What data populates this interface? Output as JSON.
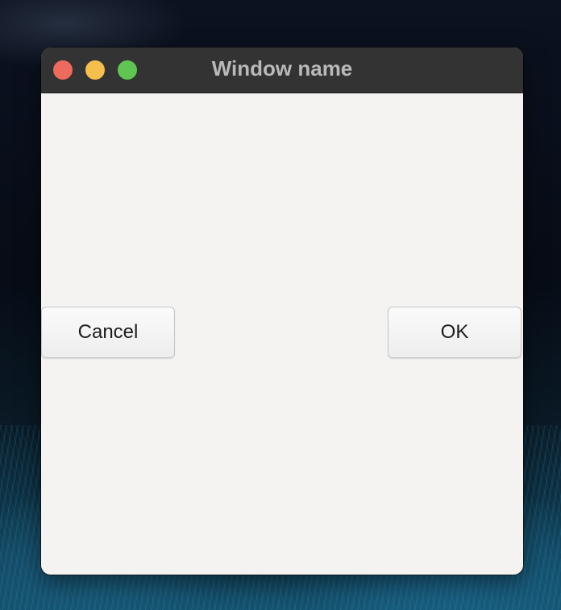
{
  "window": {
    "title": "Window name"
  },
  "buttons": {
    "cancel_label": "Cancel",
    "ok_label": "OK"
  },
  "traffic_lights": {
    "close_color": "#ed6a5e",
    "minimize_color": "#f5bf4f",
    "zoom_color": "#61c554"
  }
}
